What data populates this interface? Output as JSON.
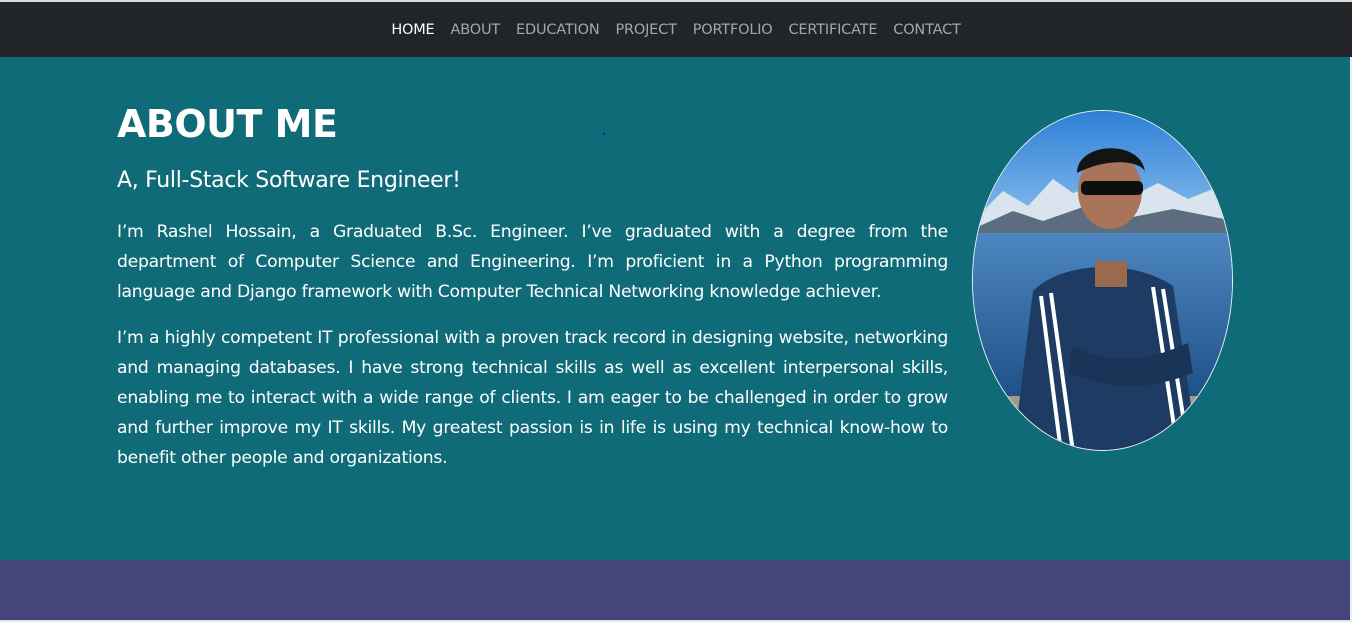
{
  "nav": {
    "items": [
      {
        "label": "HOME",
        "active": true
      },
      {
        "label": "ABOUT",
        "active": false
      },
      {
        "label": "EDUCATION",
        "active": false
      },
      {
        "label": "PROJECT",
        "active": false
      },
      {
        "label": "PORTFOLIO",
        "active": false
      },
      {
        "label": "CERTIFICATE",
        "active": false
      },
      {
        "label": "CONTACT",
        "active": false
      }
    ]
  },
  "about": {
    "title": "ABOUT ME",
    "subtitle": "A, Full-Stack Software Engineer!",
    "paragraphs": [
      "I’m Rashel Hossain, a Graduated B.Sc. Engineer. I’ve graduated with a degree from the department of Computer Science and Engineering. I’m proficient in a Python programming language and Django framework with Computer Technical Networking knowledge achiever.",
      "I’m a highly competent IT professional with a proven track record in designing website, networking and managing databases. I have strong technical skills as well as excellent interpersonal skills, enabling me to interact with a wide range of clients. I am eager to be challenged in order to grow and further improve my IT skills. My greatest passion is in life is using my technical know-how to benefit other people and organizations."
    ]
  },
  "colors": {
    "navbar": "#212529",
    "about_bg": "#106b78",
    "next_section_bg": "#45457a",
    "nav_active": "#ffffff",
    "nav_inactive": "#a3a7ab"
  }
}
